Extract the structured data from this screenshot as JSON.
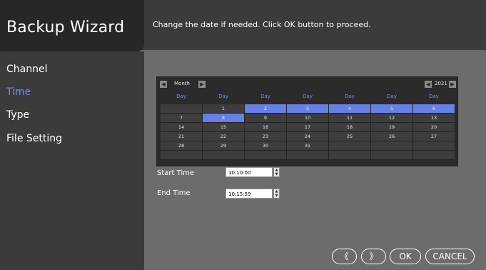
{
  "header": {
    "title": "Backup Wizard",
    "instruction": "Change the date if needed. Click OK button to proceed."
  },
  "sidebar": {
    "items": [
      {
        "label": "Channel",
        "active": false
      },
      {
        "label": "Time",
        "active": true
      },
      {
        "label": "Type",
        "active": false
      },
      {
        "label": "File Setting",
        "active": false
      }
    ]
  },
  "calendar": {
    "month_label": "Month",
    "year_label": "2021",
    "day_headers": [
      "Day",
      "Day",
      "Day",
      "Day",
      "Day",
      "Day",
      "Day"
    ],
    "weeks": [
      [
        "",
        "1",
        "2",
        "3",
        "4",
        "5",
        "6"
      ],
      [
        "7",
        "8",
        "9",
        "10",
        "11",
        "12",
        "13"
      ],
      [
        "14",
        "15",
        "16",
        "17",
        "18",
        "19",
        "20"
      ],
      [
        "21",
        "22",
        "23",
        "24",
        "25",
        "26",
        "27"
      ],
      [
        "28",
        "29",
        "30",
        "31",
        "",
        "",
        ""
      ],
      [
        "",
        "",
        "",
        "",
        "",
        "",
        ""
      ]
    ],
    "highlighted": [
      "2",
      "3",
      "4",
      "5",
      "6",
      "8"
    ],
    "highlight_color": "#6680e6"
  },
  "time": {
    "start_label": "Start Time",
    "start_value": "10:10:00",
    "end_label": "End Time",
    "end_value": "10:15:59"
  },
  "buttons": {
    "prev": "《",
    "next": "》",
    "ok": "OK",
    "cancel": "CANCEL"
  },
  "icons": {
    "month_prev": "triangle-left",
    "month_next": "triangle-right",
    "year_prev": "triangle-left",
    "year_next": "triangle-right"
  }
}
